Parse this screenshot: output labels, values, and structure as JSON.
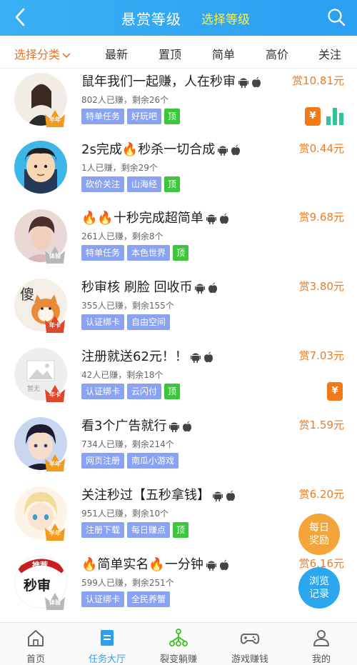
{
  "header": {
    "title": "悬赏等级",
    "select_level": "选择等级"
  },
  "filters": [
    {
      "label": "选择分类",
      "active": true
    },
    {
      "label": "最新"
    },
    {
      "label": "置顶"
    },
    {
      "label": "简单"
    },
    {
      "label": "高价"
    },
    {
      "label": "关注"
    }
  ],
  "tasks": [
    {
      "title": "鼠年我们一起赚，人在秒审",
      "meta": "802人已赚，剩余26个",
      "tags": [
        "特单任务",
        "好玩吧"
      ],
      "top": "顶",
      "reward": "赏10.81元",
      "crown": "半年"
    },
    {
      "title": "2s完成🔥秒杀一切合成",
      "meta": "1人已赚，剩余29个",
      "tags": [
        "砍价关注",
        "山海经"
      ],
      "top": "顶",
      "reward": "赏0.44元",
      "crown": ""
    },
    {
      "title": "🔥🔥十秒完成超简单",
      "meta": "261人已赚，剩余8个",
      "tags": [
        "特单任务",
        "本色世界"
      ],
      "top": "顶",
      "reward": "赏9.68元",
      "crown": "体验"
    },
    {
      "title": "秒审核 刷脸 回收币",
      "meta": "355人已赚，剩余155个",
      "tags": [
        "认证绑卡",
        "自由空间"
      ],
      "top": "",
      "reward": "赏3.80元",
      "crown": "年卡"
    },
    {
      "title": "注册就送62元！！",
      "meta": "42人已赚，剩余18个",
      "tags": [
        "认证绑卡",
        "云闪付"
      ],
      "top": "顶",
      "reward": "赏7.03元",
      "crown": "年卡"
    },
    {
      "title": "看3个广告就行",
      "meta": "734人已赚，剩余214个",
      "tags": [
        "网页注册",
        "南瓜小游戏"
      ],
      "top": "",
      "reward": "赏1.59元",
      "crown": "半年"
    },
    {
      "title": "关注秒过【五秒拿钱】",
      "meta": "951人已赚，剩余10个",
      "tags": [
        "注册下载",
        "每日赚点"
      ],
      "top": "顶",
      "reward": "赏6.20元",
      "crown": "半年"
    },
    {
      "title": "🔥简单实名🔥一分钟",
      "meta": "599人已赚，剩余251个",
      "tags": [
        "认证绑卡",
        "全民养蟹"
      ],
      "top": "",
      "reward": "赏6.16元",
      "crown": "体验"
    }
  ],
  "avatar_text": {
    "shy": "傻",
    "placeholder": "暂无",
    "recommend": "推荐",
    "miaoshen": "秒审"
  },
  "badges": {
    "coin": "¥"
  },
  "floating": {
    "daily_line1": "每日",
    "daily_line2": "奖励",
    "history_line1": "浏览",
    "history_line2": "记录"
  },
  "bottom_nav": [
    {
      "label": "首页",
      "icon": "home-icon"
    },
    {
      "label": "任务大厅",
      "icon": "task-hall-icon",
      "active": true
    },
    {
      "label": "裂变躺赚",
      "icon": "fission-icon"
    },
    {
      "label": "游戏赚钱",
      "icon": "gamepad-icon"
    },
    {
      "label": "我的",
      "icon": "user-icon"
    }
  ],
  "colors": {
    "header": "#2b9ff0",
    "accent_orange": "#ee7b22",
    "tag_blue": "#8aa2f2",
    "tag_green": "#3cc63c",
    "select_level": "#fff14a"
  }
}
